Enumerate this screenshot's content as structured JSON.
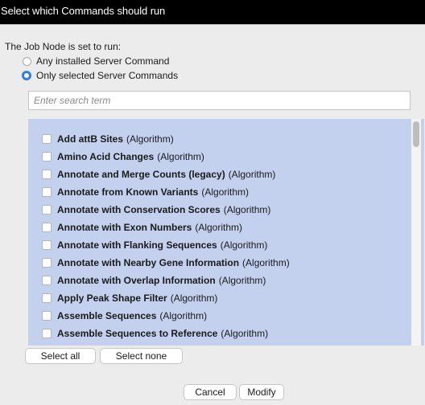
{
  "window": {
    "title": "Select which Commands should run"
  },
  "intro_text": "The Job Node is set to run:",
  "options": [
    {
      "label": "Any installed Server Command",
      "selected": false
    },
    {
      "label": "Only selected Server Commands",
      "selected": true
    }
  ],
  "search": {
    "placeholder": "Enter search term",
    "value": ""
  },
  "commands": [
    {
      "name": "Add attB Sites",
      "kind": "(Algorithm)",
      "checked": false
    },
    {
      "name": "Amino Acid Changes",
      "kind": "(Algorithm)",
      "checked": false
    },
    {
      "name": "Annotate and Merge Counts (legacy)",
      "kind": "(Algorithm)",
      "checked": false
    },
    {
      "name": "Annotate from Known Variants",
      "kind": "(Algorithm)",
      "checked": false
    },
    {
      "name": "Annotate with Conservation Scores",
      "kind": "(Algorithm)",
      "checked": false
    },
    {
      "name": "Annotate with Exon Numbers",
      "kind": "(Algorithm)",
      "checked": false
    },
    {
      "name": "Annotate with Flanking Sequences",
      "kind": "(Algorithm)",
      "checked": false
    },
    {
      "name": "Annotate with Nearby Gene Information",
      "kind": "(Algorithm)",
      "checked": false
    },
    {
      "name": "Annotate with Overlap Information",
      "kind": "(Algorithm)",
      "checked": false
    },
    {
      "name": "Apply Peak Shape Filter",
      "kind": "(Algorithm)",
      "checked": false
    },
    {
      "name": "Assemble Sequences",
      "kind": "(Algorithm)",
      "checked": false
    },
    {
      "name": "Assemble Sequences to Reference",
      "kind": "(Algorithm)",
      "checked": false
    }
  ],
  "list_buttons": {
    "select_all": "Select all",
    "select_none": "Select none"
  },
  "footer": {
    "cancel": "Cancel",
    "modify": "Modify"
  },
  "colors": {
    "accent": "#2f7fe8",
    "list_background": "#c3d0ee",
    "title_bar": "#000000"
  }
}
